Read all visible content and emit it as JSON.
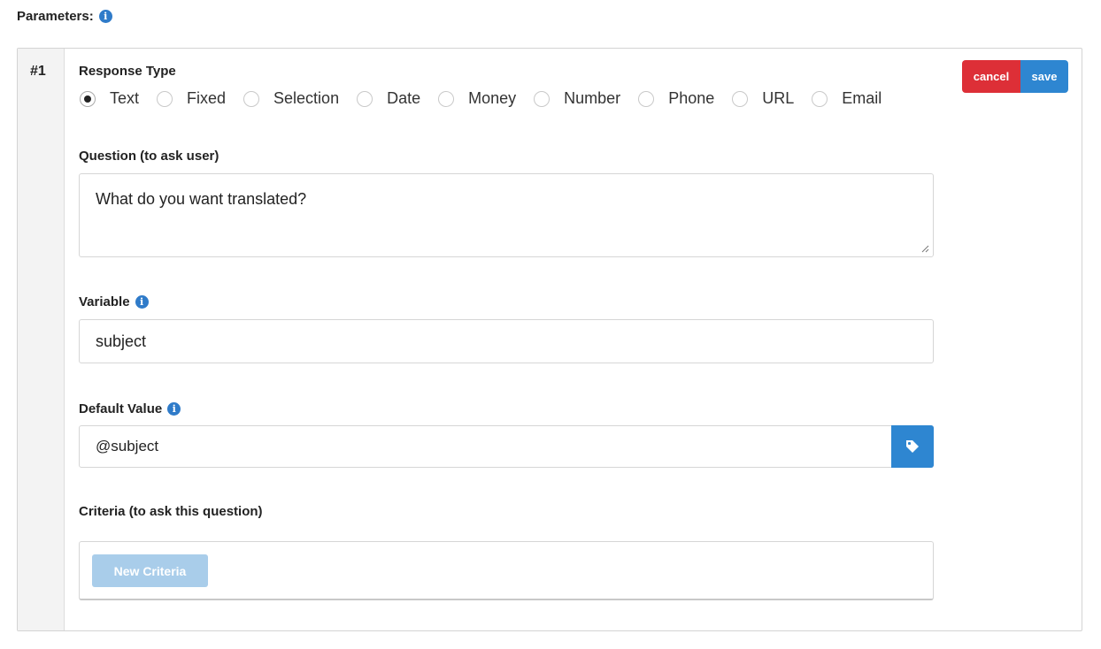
{
  "parameters": {
    "title": "Parameters:",
    "info_icon": "info-icon"
  },
  "param": {
    "number": "#1",
    "actions": {
      "cancel_label": "cancel",
      "save_label": "save",
      "cancel_color": "#dd2f37",
      "save_color": "#2e86d1"
    },
    "response_type": {
      "label": "Response Type",
      "selected": "Text",
      "options": [
        "Text",
        "Fixed",
        "Selection",
        "Date",
        "Money",
        "Number",
        "Phone",
        "URL",
        "Email"
      ]
    },
    "question": {
      "label": "Question (to ask user)",
      "value": "What do you want translated?"
    },
    "variable": {
      "label": "Variable",
      "value": "subject"
    },
    "default_value": {
      "label": "Default Value",
      "value": "@subject",
      "button_icon": "tag-icon"
    },
    "criteria": {
      "label": "Criteria (to ask this question)",
      "button_label": "New Criteria"
    }
  }
}
